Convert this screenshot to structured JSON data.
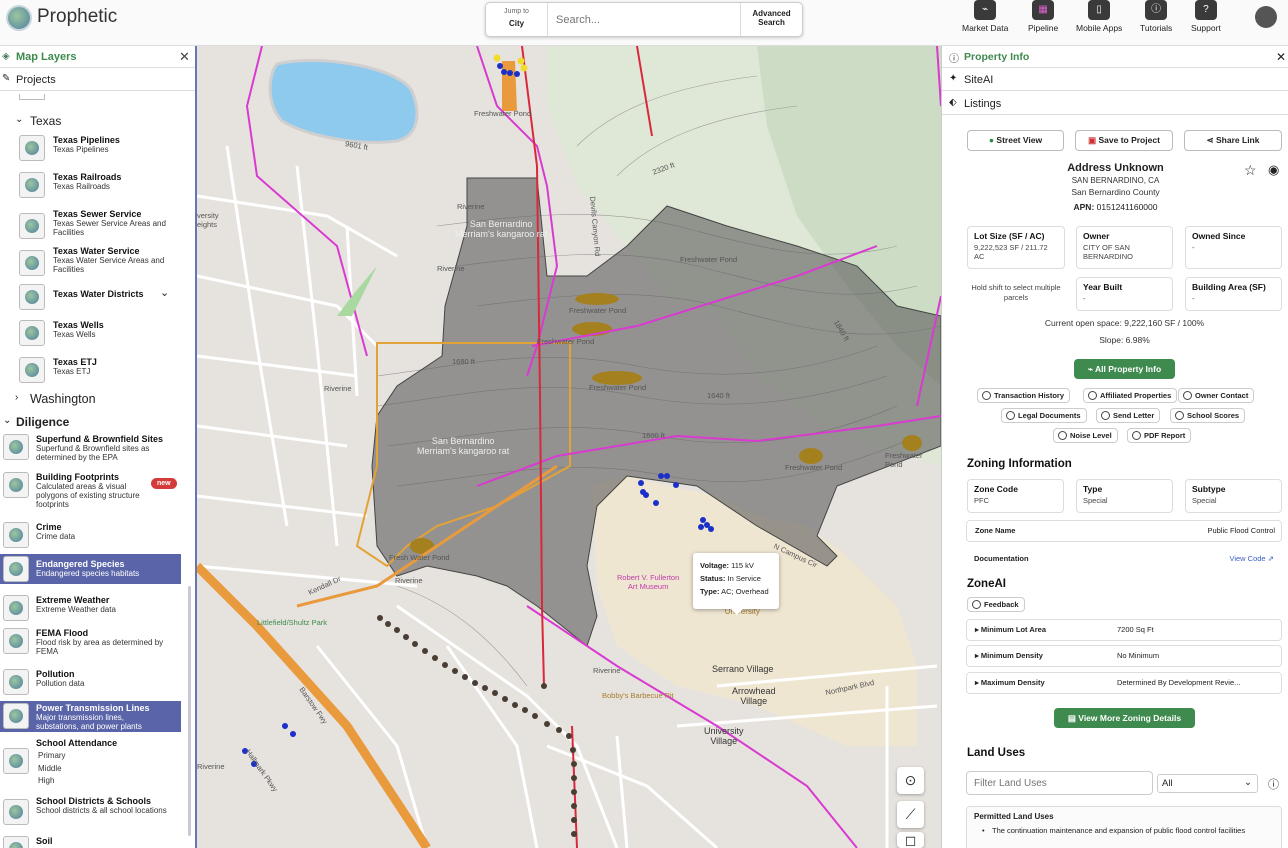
{
  "header": {
    "brand": "Prophetic",
    "jump_label": "Jump to",
    "jump_value": "City",
    "search_placeholder": "Search...",
    "advanced_search": "Advanced Search",
    "nav": [
      {
        "label": "Market Data",
        "icon": "chart-icon"
      },
      {
        "label": "Pipeline",
        "icon": "grid-icon"
      },
      {
        "label": "Mobile Apps",
        "icon": "phone-icon"
      },
      {
        "label": "Tutorials",
        "icon": "info-icon"
      },
      {
        "label": "Support",
        "icon": "help-icon"
      }
    ]
  },
  "left": {
    "title": "Map Layers",
    "projects": "Projects",
    "texas_group": "Texas",
    "texas_items": [
      {
        "title": "Texas Pipelines",
        "desc": "Texas Pipelines"
      },
      {
        "title": "Texas Railroads",
        "desc": "Texas Railroads"
      },
      {
        "title": "Texas Sewer Service",
        "desc": "Texas Sewer Service Areas and Facilities"
      },
      {
        "title": "Texas Water Service",
        "desc": "Texas Water Service Areas and Facilities"
      },
      {
        "title": "Texas Water Districts",
        "desc": ""
      },
      {
        "title": "Texas Wells",
        "desc": "Texas Wells"
      },
      {
        "title": "Texas ETJ",
        "desc": "Texas ETJ"
      }
    ],
    "washington": "Washington",
    "diligence": "Diligence",
    "diligence_items": [
      {
        "title": "Superfund & Brownfield Sites",
        "desc": "Superfund & Brownfield sites as determined by the EPA"
      },
      {
        "title": "Building Footprints",
        "desc": "Calculated areas & visual polygons of existing structure footprints",
        "badge": "new"
      },
      {
        "title": "Crime",
        "desc": "Crime data"
      },
      {
        "title": "Endangered Species",
        "desc": "Endangered species habitats",
        "selected": true
      },
      {
        "title": "Extreme Weather",
        "desc": "Extreme Weather data"
      },
      {
        "title": "FEMA Flood",
        "desc": "Flood risk by area as determined by FEMA"
      },
      {
        "title": "Pollution",
        "desc": "Pollution data"
      },
      {
        "title": "Power Transmission Lines",
        "desc": "Major transmission lines, substations, and power plants",
        "selected": true
      },
      {
        "title": "School Attendance",
        "desc": "Primary\nMiddle\nHigh"
      },
      {
        "title": "School Districts & Schools",
        "desc": "School districts & all school locations"
      },
      {
        "title": "Soil",
        "desc": ""
      }
    ]
  },
  "map": {
    "popup": {
      "voltage_label": "Voltage:",
      "voltage": "115 kV",
      "status_label": "Status:",
      "status": "In Service",
      "type_label": "Type:",
      "type": "AC; Overhead"
    },
    "labels": {
      "habitat1": "San Bernardino\nMerriam's kangaroo rat",
      "habitat2": "San Bernardino\nMerriam's kangaroo rat",
      "pond1": "Freshwater Pond",
      "pond2": "Freshwater Pond",
      "pond3": "Freshwater Pond",
      "pond4": "Freshwater Pond",
      "pond5": "Freshwater Pond",
      "pond6": "Freshwater Pond",
      "pond7": "Fresh Water Pond",
      "rd1": "Devils Canyon Rd",
      "museum": "Robert V. Fullerton\nArt Museum",
      "csu": "California State\nUniversity",
      "serrano": "Serrano Village",
      "arrowhead": "Arrowhead\nVillage",
      "univ": "University\nVillage",
      "park": "Littlefield/Shultz Park",
      "bbq": "Bobby's Barbecue Pit",
      "northpark": "Northpark Blvd",
      "kendall": "Kendall Dr",
      "campus": "N Campus Cir",
      "hallmark": "Hallmark Pkwy",
      "barstow": "Barstow Fwy",
      "heights": "versity\neights",
      "f9601": "9601 ft",
      "f1600": "1600 ft",
      "f1680": "1680 ft",
      "f1640": "1640 ft",
      "f1840": "1840 ft",
      "f2320": "2320 ft",
      "riverine": "Riverine"
    }
  },
  "right": {
    "title": "Property Info",
    "siteai": "SiteAI",
    "listings": "Listings",
    "street_view": "Street View",
    "save_project": "Save to Project",
    "share_link": "Share Link",
    "address": "Address Unknown",
    "city": "SAN BERNARDINO, CA",
    "county": "San Bernardino County",
    "apn_label": "APN:",
    "apn": "0151241160000",
    "lot_size_label": "Lot Size (SF / AC)",
    "lot_size": "9,222,523 SF / 211.72 AC",
    "owner_label": "Owner",
    "owner": "CITY OF SAN BERNARDINO",
    "owned_since_label": "Owned Since",
    "owned_since": "-",
    "shift_hint": "Hold shift to select multiple parcels",
    "year_built_label": "Year Built",
    "year_built": "-",
    "building_area_label": "Building Area (SF)",
    "building_area": "-",
    "open_space": "Current open space: 9,222,160 SF / 100%",
    "slope": "Slope: 6.98%",
    "all_property_info": "All Property Info",
    "chips": [
      "Transaction History",
      "Affiliated Properties",
      "Owner Contact",
      "Legal Documents",
      "Send Letter",
      "School Scores",
      "Noise Level",
      "PDF Report"
    ],
    "zoning_title": "Zoning Information",
    "zone_code_label": "Zone Code",
    "zone_code": "PFC",
    "type_label": "Type",
    "type": "Special",
    "subtype_label": "Subtype",
    "subtype": "Special",
    "zone_name_label": "Zone Name",
    "zone_name": "Public Flood Control",
    "documentation_label": "Documentation",
    "view_code": "View Code",
    "zoneai_title": "ZoneAI",
    "feedback": "Feedback",
    "zoneai_rows": [
      {
        "label": "Minimum Lot Area",
        "value": "7200 Sq Ft"
      },
      {
        "label": "Minimum Density",
        "value": "No Minimum"
      },
      {
        "label": "Maximum Density",
        "value": "Determined By Development Revie..."
      }
    ],
    "view_more_zoning": "View More Zoning Details",
    "land_uses_title": "Land Uses",
    "filter_placeholder": "Filter Land Uses",
    "filter_select": "All",
    "permitted_title": "Permitted Land Uses",
    "permitted_item": "The continuation maintenance and expansion of public flood control facilities"
  },
  "colors": {
    "accent": "#5a64a8",
    "green": "#3f8a4e",
    "transmission": "#d9283b",
    "highway": "#e89a3c",
    "boundary": "#d93ad0"
  }
}
